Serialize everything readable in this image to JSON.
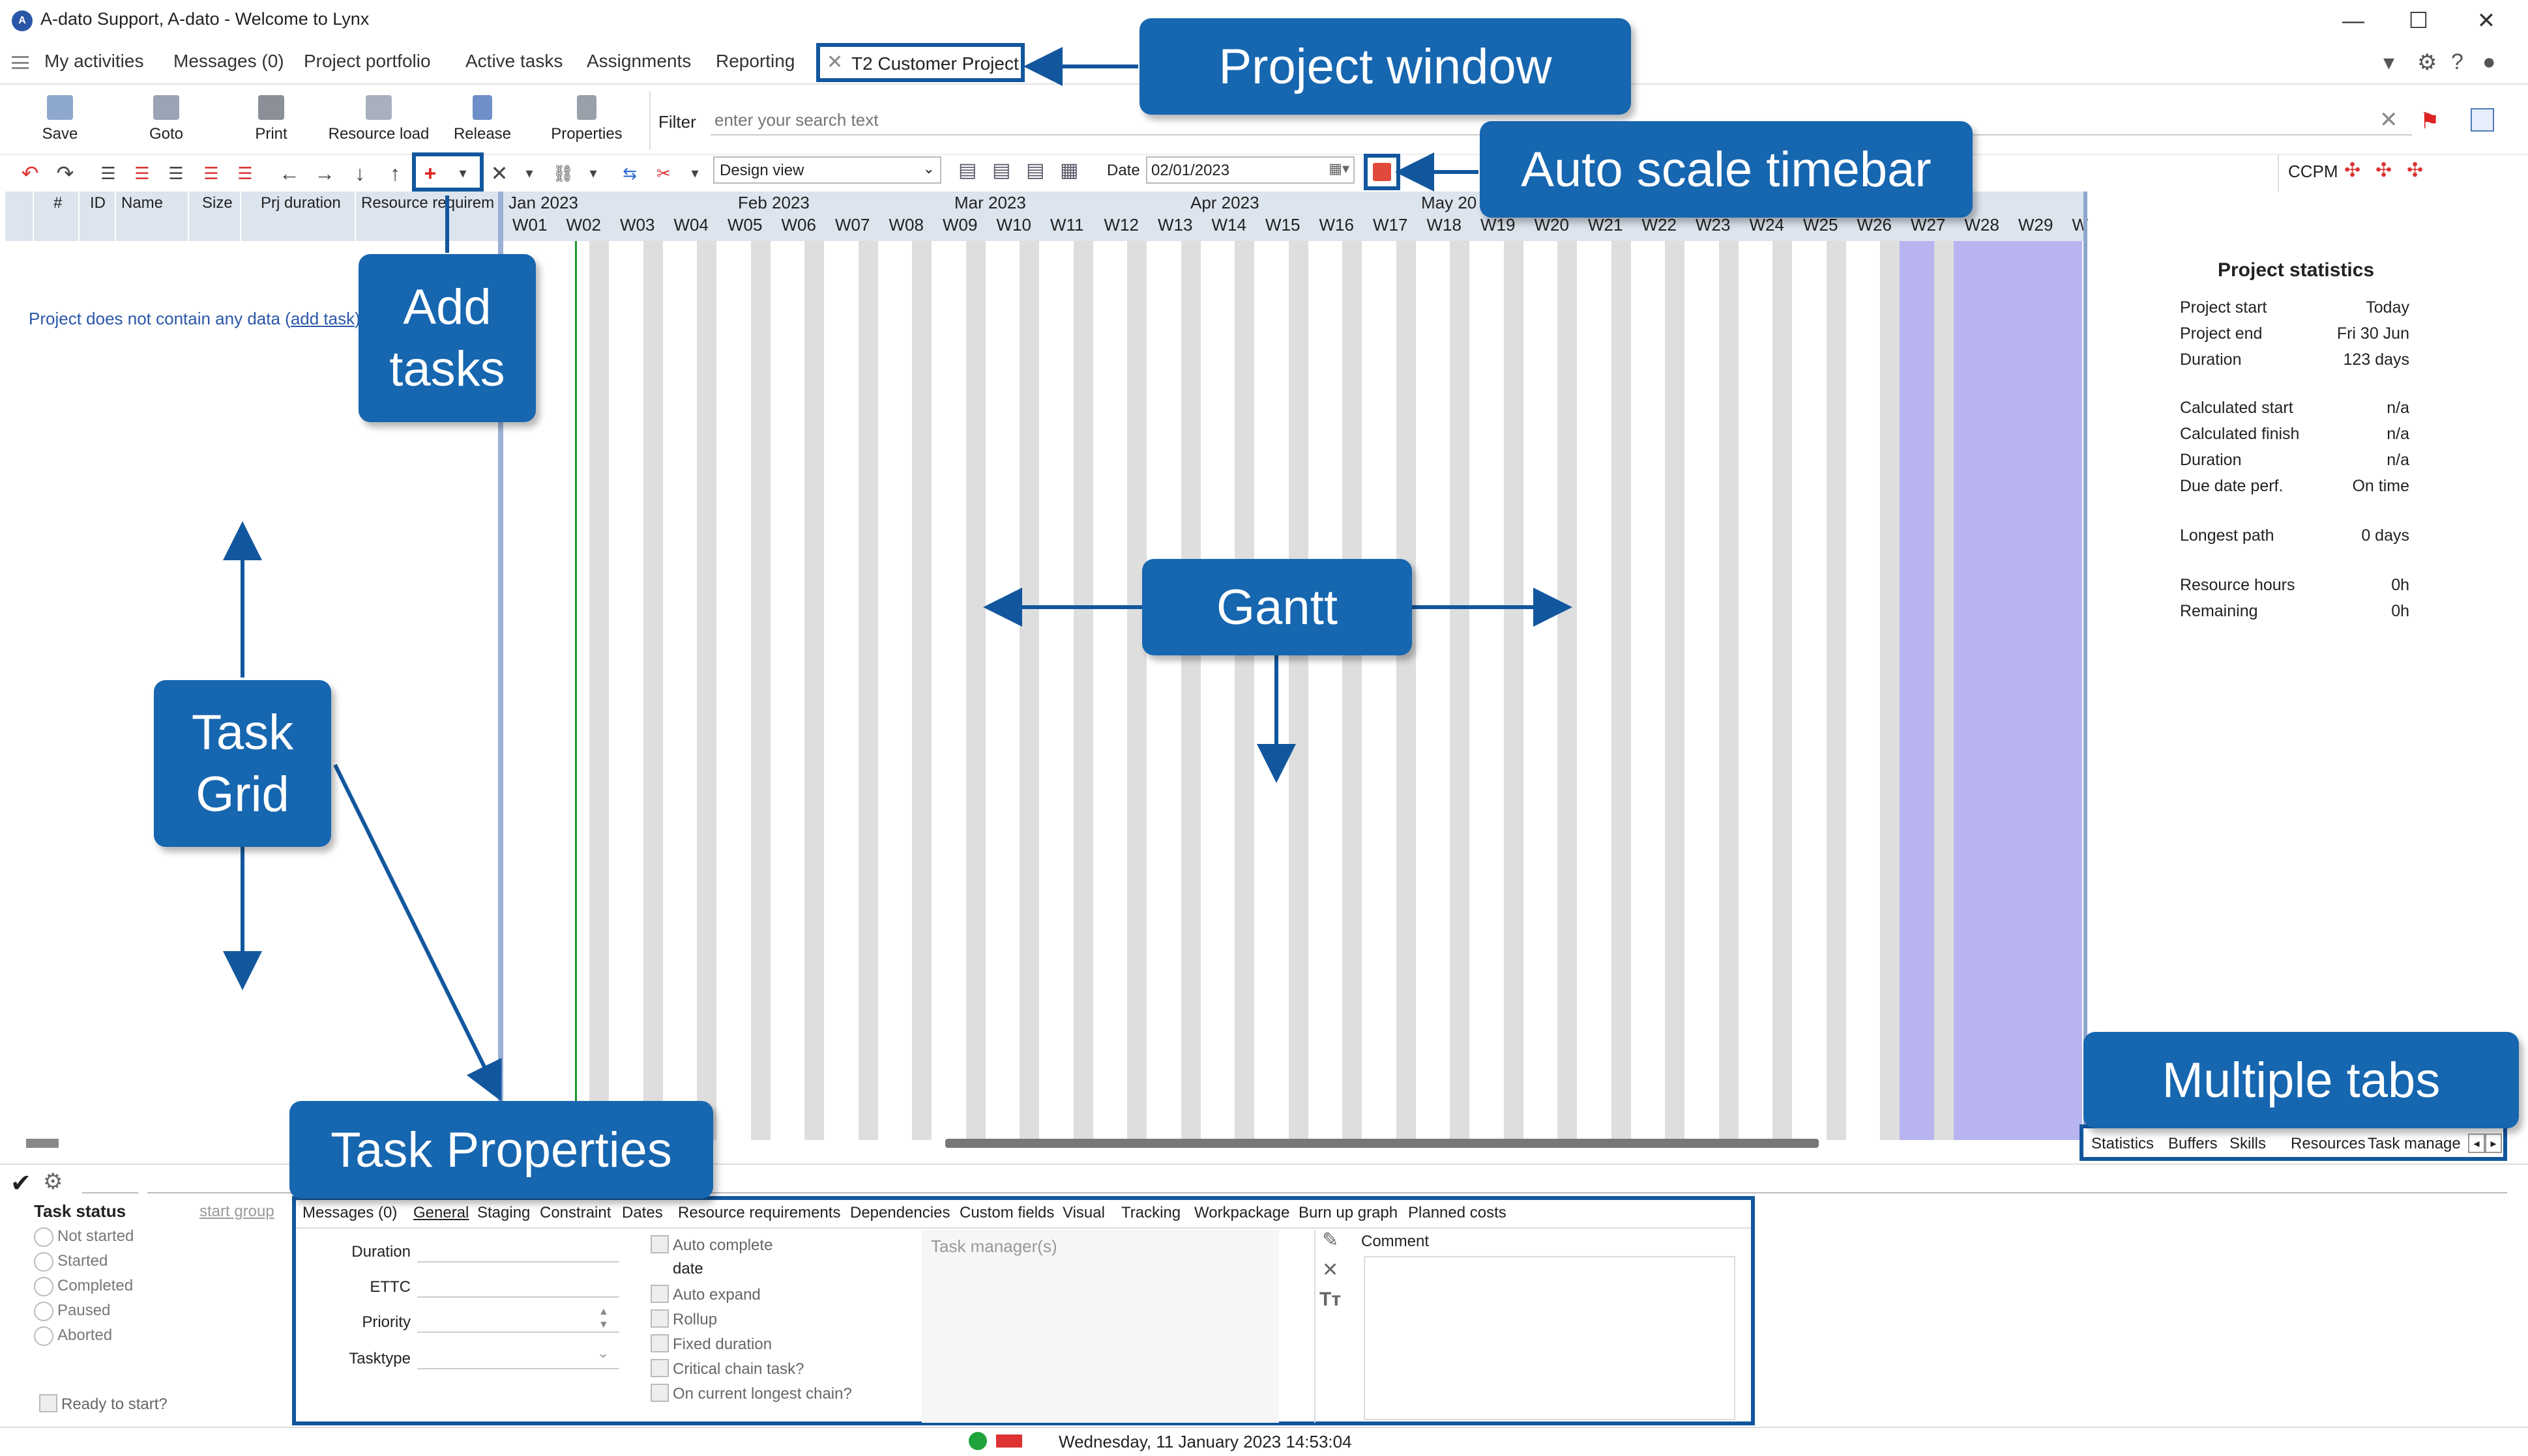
{
  "window": {
    "title": "A-dato Support, A-dato - Welcome to Lynx",
    "minimize": "—",
    "maximize": "☐",
    "close": "✕"
  },
  "menu": {
    "items": [
      "My activities",
      "Messages (0)",
      "Project portfolio",
      "Active tasks",
      "Assignments",
      "Reporting"
    ],
    "project_tab": "T2 Customer Project"
  },
  "ribbon": {
    "buttons": [
      "Save",
      "Goto",
      "Print",
      "Resource load",
      "Release",
      "Properties"
    ],
    "filter_label": "Filter",
    "filter_placeholder": "enter your search text"
  },
  "toolbar": {
    "view": "Design view",
    "date_label": "Date",
    "date_value": "02/01/2023",
    "ccpm": "CCPM"
  },
  "grid": {
    "columns": [
      "#",
      "ID",
      "Name",
      "Size",
      "Prj duration",
      "Resource requirem"
    ],
    "empty_message": "Project does not contain any data (",
    "add_task_link": "add task",
    "empty_close": ")"
  },
  "timeline": {
    "months": [
      "Jan 2023",
      "Feb 2023",
      "Mar 2023",
      "Apr 2023",
      "May 20"
    ],
    "weeks": [
      "W01",
      "W02",
      "W03",
      "W04",
      "W05",
      "W06",
      "W07",
      "W08",
      "W09",
      "W10",
      "W11",
      "W12",
      "W13",
      "W14",
      "W15",
      "W16",
      "W17",
      "W18",
      "W19",
      "W20",
      "W21",
      "W22",
      "W23",
      "W24",
      "W25",
      "W26",
      "W27",
      "W28",
      "W29",
      "W"
    ]
  },
  "stats": {
    "title": "Project statistics",
    "rows": [
      {
        "label": "Project start",
        "value": "Today"
      },
      {
        "label": "Project end",
        "value": "Fri 30 Jun"
      },
      {
        "label": "Duration",
        "value": "123 days"
      },
      {
        "label": "Calculated start",
        "value": "n/a"
      },
      {
        "label": "Calculated finish",
        "value": "n/a"
      },
      {
        "label": "Duration",
        "value": "n/a"
      },
      {
        "label": "Due date perf.",
        "value": "On time"
      },
      {
        "label": "Longest path",
        "value": "0 days"
      },
      {
        "label": "Resource hours",
        "value": "0h"
      },
      {
        "label": "Remaining",
        "value": "0h"
      }
    ]
  },
  "side_tabs": [
    "Statistics",
    "Buffers",
    "Skills",
    "Resources",
    "Task manage"
  ],
  "task_status": {
    "title": "Task status",
    "start_group": "start group",
    "options": [
      "Not started",
      "Started",
      "Completed",
      "Paused",
      "Aborted"
    ],
    "ready": "Ready to start?"
  },
  "properties": {
    "tabs": [
      "Messages (0)",
      "General",
      "Staging",
      "Constraint",
      "Dates",
      "Resource requirements",
      "Dependencies",
      "Custom fields",
      "Visual",
      "Tracking",
      "Workpackage",
      "Burn up graph",
      "Planned costs"
    ],
    "fields": [
      "Duration",
      "ETTC",
      "Priority",
      "Tasktype"
    ],
    "checkboxes": [
      "Auto complete",
      "date",
      "Auto expand",
      "Rollup",
      "Fixed duration",
      "Critical chain task?",
      "On current longest chain?"
    ],
    "task_managers": "Task manager(s)",
    "comment": "Comment"
  },
  "statusbar": {
    "datetime": "Wednesday, 11 January 2023 14:53:04"
  },
  "callouts": {
    "project_window": "Project window",
    "auto_scale": "Auto scale timebar",
    "add_tasks": "Add tasks",
    "gantt": "Gantt",
    "task_grid": "Task Grid",
    "multiple_tabs": "Multiple tabs",
    "task_properties": "Task Properties"
  },
  "colors": {
    "callout": "#1666b0",
    "grid_header": "#dce4ee",
    "gantt_stripe": "#dedede",
    "gantt_weekend_blue": "#b8b4f0",
    "today_line": "#1b9a2a"
  }
}
